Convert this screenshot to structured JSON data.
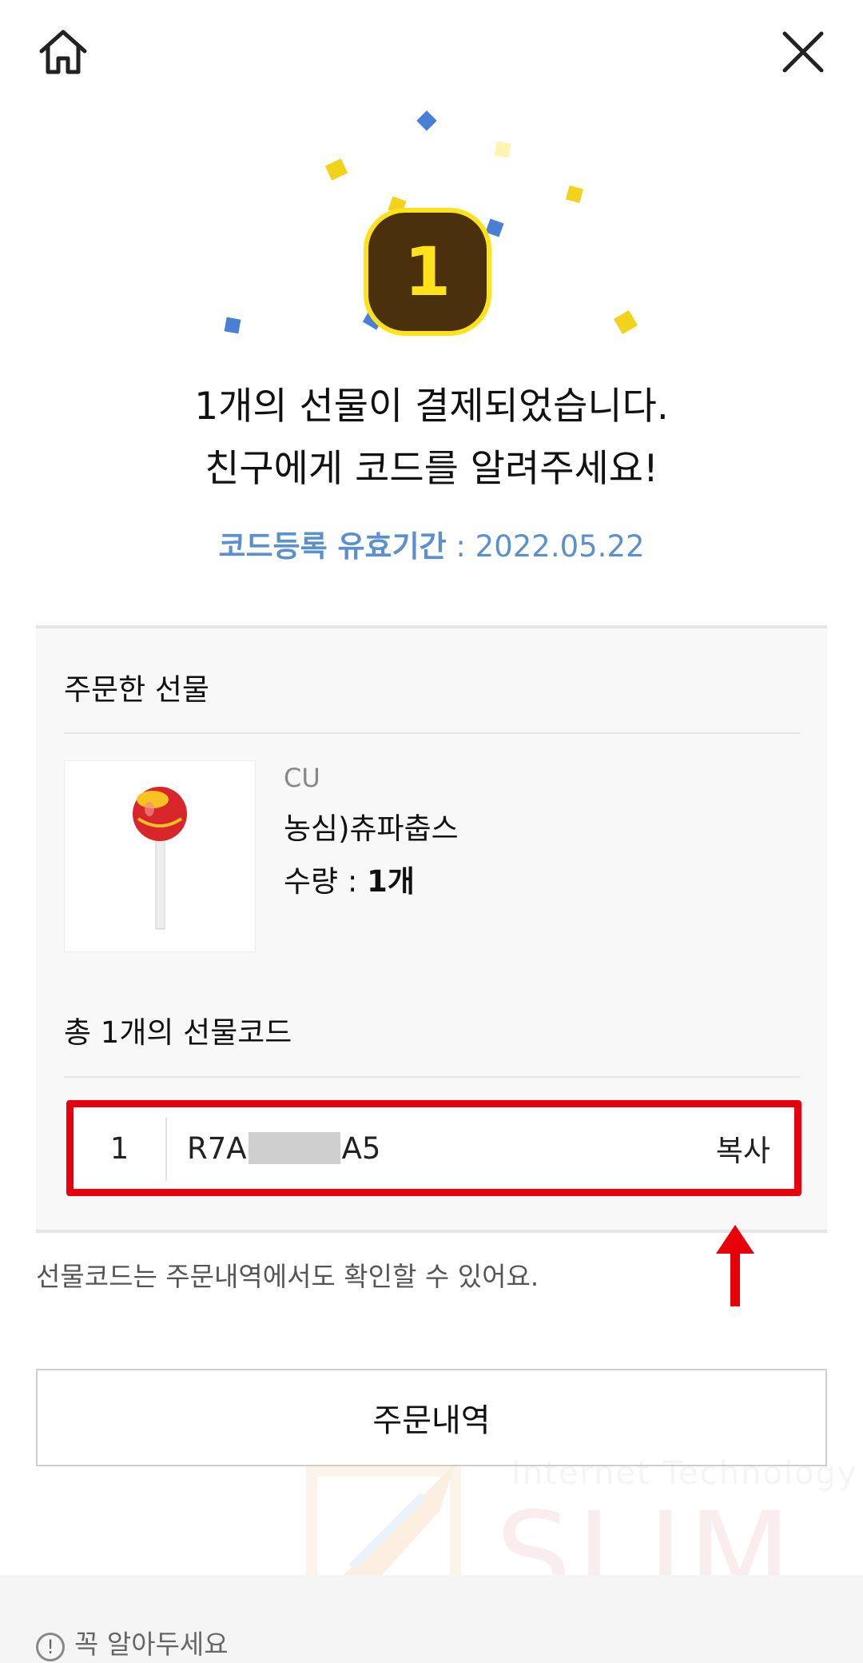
{
  "header": {
    "home_icon": "home-icon",
    "close_icon": "close-icon"
  },
  "badge": {
    "count": "1"
  },
  "headline": {
    "line1": "1개의 선물이 결제되었습니다.",
    "line2": "친구에게 코드를 알려주세요!"
  },
  "validity": {
    "label": "코드등록 유효기간",
    "separator": " : ",
    "date": "2022.05.22"
  },
  "order": {
    "section_title": "주문한 선물",
    "product": {
      "brand": "CU",
      "name": "농심)츄파춥스",
      "quantity_label": "수량 : ",
      "quantity_value": "1개"
    },
    "codes_title": "총 1개의 선물코드",
    "codes": [
      {
        "index": "1",
        "prefix": "R7A",
        "suffix": "A5",
        "copy_label": "복사"
      }
    ]
  },
  "notice": "선물코드는 주문내역에서도 확인할 수 있어요.",
  "order_history_button": "주문내역",
  "watermark": {
    "subtitle": "Internet Technology",
    "logo": "SLIM"
  },
  "bottom_tip": "꼭 알아두세요",
  "colors": {
    "badge_bg": "#4a300d",
    "badge_accent": "#ffe21a",
    "validity_text": "#5b8fce",
    "highlight": "#e8000b"
  }
}
